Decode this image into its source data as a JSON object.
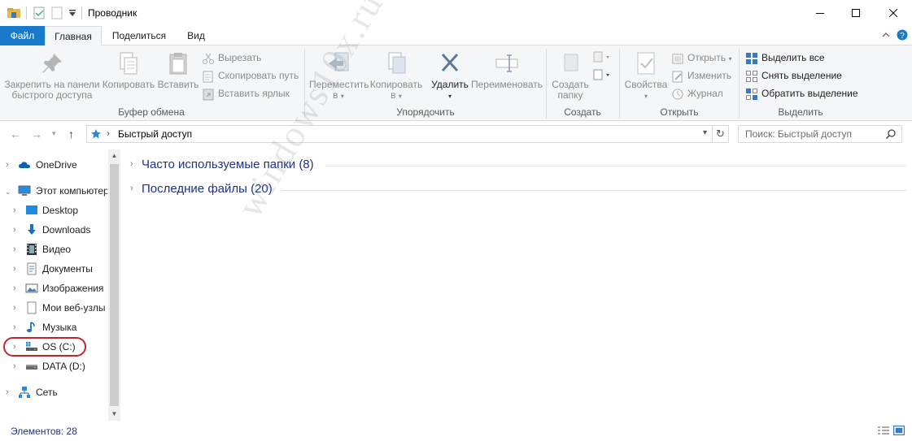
{
  "window": {
    "title": "Проводник",
    "controls": [
      "minimize",
      "maximize",
      "close"
    ]
  },
  "ribbon_tabs": [
    {
      "label": "Файл"
    },
    {
      "label": "Главная"
    },
    {
      "label": "Поделиться"
    },
    {
      "label": "Вид"
    }
  ],
  "ribbon": {
    "clipboard": {
      "group_name": "Буфер обмена",
      "pin_line1": "Закрепить на панели",
      "pin_line2": "быстрого доступа",
      "copy": "Копировать",
      "paste": "Вставить",
      "cut": "Вырезать",
      "copy_path": "Скопировать путь",
      "paste_shortcut": "Вставить ярлык"
    },
    "organize": {
      "group_name": "Упорядочить",
      "move_line1": "Переместить",
      "move_line2": "в",
      "copy_line1": "Копировать",
      "copy_line2": "в",
      "delete": "Удалить",
      "rename": "Переименовать"
    },
    "create": {
      "group_name": "Создать",
      "new_folder_line1": "Создать",
      "new_folder_line2": "папку"
    },
    "open": {
      "group_name": "Открыть",
      "properties": "Свойства",
      "open": "Открыть",
      "edit": "Изменить",
      "history": "Журнал"
    },
    "select": {
      "group_name": "Выделить",
      "select_all": "Выделить все",
      "select_none": "Снять выделение",
      "invert": "Обратить выделение"
    }
  },
  "address": {
    "path": "Быстрый доступ",
    "search_placeholder": "Поиск: Быстрый доступ"
  },
  "nav": {
    "onedrive": "OneDrive",
    "this_pc": "Этот компьютер",
    "desktop": "Desktop",
    "downloads": "Downloads",
    "video": "Видео",
    "documents": "Документы",
    "pictures": "Изображения",
    "web_nodes": "Мои веб-узлы",
    "music": "Музыка",
    "os_c": "OS (C:)",
    "data_d": "DATA (D:)",
    "network": "Сеть"
  },
  "content": {
    "frequent": "Часто используемые папки (8)",
    "recent": "Последние файлы (20)"
  },
  "watermark": "windows10x.ru",
  "status": {
    "items": "Элементов: 28"
  },
  "colors": {
    "accent": "#1979ca",
    "highlight_ring": "#c0272d",
    "section_title": "#1e3287"
  }
}
